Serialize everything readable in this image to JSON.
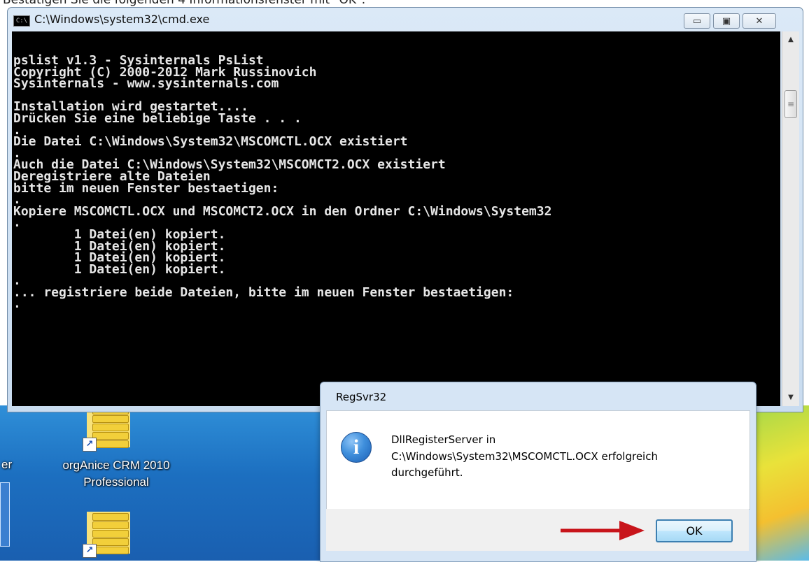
{
  "caption": {
    "text": "Bestätigen Sie die folgenden 4 Informationsfenster mit \"OK\"."
  },
  "cmd_window": {
    "title": "C:\\Windows\\system32\\cmd.exe",
    "icon": "C:\\",
    "buttons": {
      "minimize": "▭",
      "maximize": "▣",
      "close": "✕"
    },
    "console_lines": [
      "pslist v1.3 - Sysinternals PsList",
      "Copyright (C) 2000-2012 Mark Russinovich",
      "Sysinternals - www.sysinternals.com",
      "",
      "Installation wird gestartet....",
      "Drücken Sie eine beliebige Taste . . .",
      ".",
      "Die Datei C:\\Windows\\System32\\MSCOMCTL.OCX existiert",
      ".",
      "Auch die Datei C:\\Windows\\System32\\MSCOMCT2.OCX existiert",
      "Deregistriere alte Dateien",
      "bitte im neuen Fenster bestaetigen:",
      ".",
      "Kopiere MSCOMCTL.OCX und MSCOMCT2.OCX in den Ordner C:\\Windows\\System32",
      ".",
      "        1 Datei(en) kopiert.",
      "        1 Datei(en) kopiert.",
      "        1 Datei(en) kopiert.",
      "        1 Datei(en) kopiert.",
      ".",
      "... registriere beide Dateien, bitte im neuen Fenster bestaetigen:",
      "."
    ],
    "scrollbar": {
      "up": "▲",
      "down": "▼",
      "thumb_grip": "≡"
    }
  },
  "desktop": {
    "left_fragment_label": "er",
    "icons": [
      {
        "label_line1": "orgAnice CRM 2010",
        "label_line2": "Professional"
      },
      {
        "label_line1": "",
        "label_line2": ""
      }
    ]
  },
  "dialog": {
    "title": "RegSvr32",
    "message_lines": [
      "DllRegisterServer in",
      "C:\\Windows\\System32\\MSCOMCTL.OCX erfolgreich",
      "durchgeführt."
    ],
    "ok_label": "OK",
    "icon": "info-icon"
  },
  "colors": {
    "console_bg": "#000000",
    "console_fg": "#e6e6e6",
    "arrow": "#c8151b",
    "ok_border": "#3c7fb1"
  }
}
